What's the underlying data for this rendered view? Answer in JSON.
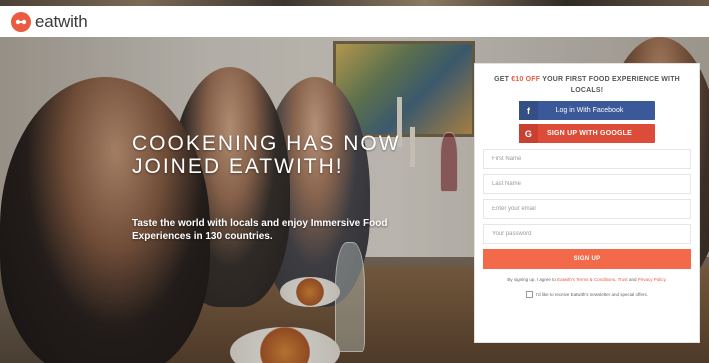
{
  "header": {
    "logo_text": "eatwith",
    "logo_icon": "eatwith-logo-icon",
    "brand_color": "#ea5b3f"
  },
  "hero": {
    "title": "COOKENING HAS NOW JOINED EATWITH!",
    "subtitle": "Taste the world with locals and enjoy Immersive Food Experiences in 130 countries."
  },
  "signup": {
    "headline_prefix": "GET ",
    "headline_promo": "€10 OFF",
    "headline_suffix": " YOUR FIRST FOOD EXPERIENCE WITH LOCALS!",
    "facebook_icon": "f",
    "facebook_label": "Log in With Facebook",
    "google_icon": "G",
    "google_label": "SIGN UP WITH GOOGLE",
    "first_name_placeholder": "First Name",
    "last_name_placeholder": "Last Name",
    "email_placeholder": "Enter your email",
    "password_placeholder": "Your password",
    "signup_label": "SIGN UP",
    "terms_prefix": "By signing up, I agree to ",
    "terms_link_1": "Eatwith's Terms & Conditions",
    "terms_sep_1": ", ",
    "terms_link_2": "Trust",
    "terms_sep_2": " and ",
    "terms_link_3": "Privacy Policy",
    "terms_suffix": ".",
    "newsletter_label": "I'd like to receive Eatwith's newsletter and special offers.",
    "facebook_color": "#3b5998",
    "google_color": "#dd4b39",
    "signup_color": "#f26a4a"
  }
}
